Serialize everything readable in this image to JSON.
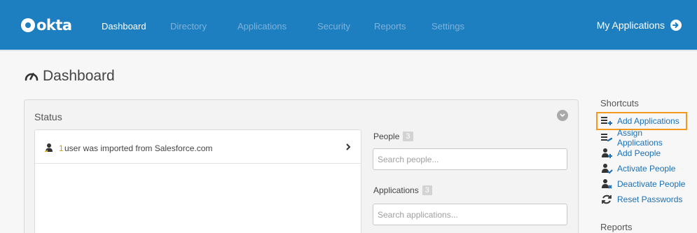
{
  "brand": {
    "logo_text": "okta",
    "accent": "#1d7fc0",
    "highlight": "#f39a1d"
  },
  "nav": {
    "items": [
      {
        "label": "Dashboard",
        "active": true
      },
      {
        "label": "Directory",
        "active": false
      },
      {
        "label": "Applications",
        "active": false
      },
      {
        "label": "Security",
        "active": false
      },
      {
        "label": "Reports",
        "active": false
      },
      {
        "label": "Settings",
        "active": false
      }
    ],
    "my_applications": "My Applications",
    "my_applications_icon": "arrow-circle-right-icon"
  },
  "page": {
    "title": "Dashboard",
    "title_icon": "gauge-icon"
  },
  "status": {
    "title": "Status",
    "notification": {
      "count": "1",
      "text": "user was imported from Salesforce.com",
      "icon": "person-icon"
    },
    "people": {
      "label": "People",
      "count": "3",
      "placeholder": "Search people..."
    },
    "applications": {
      "label": "Applications",
      "count": "3",
      "placeholder": "Search applications..."
    }
  },
  "shortcuts": {
    "title": "Shortcuts",
    "items": [
      {
        "label": "Add Applications",
        "icon": "add-apps-icon",
        "highlighted": true
      },
      {
        "label": "Assign Applications",
        "icon": "assign-apps-icon"
      },
      {
        "label": "Add People",
        "icon": "add-person-icon"
      },
      {
        "label": "Activate People",
        "icon": "activate-person-icon"
      },
      {
        "label": "Deactivate People",
        "icon": "deactivate-person-icon"
      },
      {
        "label": "Reset Passwords",
        "icon": "refresh-icon"
      }
    ]
  },
  "reports": {
    "title": "Reports"
  }
}
